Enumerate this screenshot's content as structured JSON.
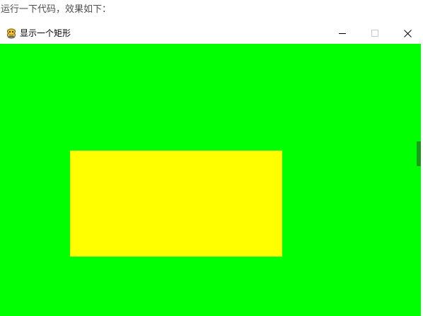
{
  "article": {
    "intro_text": "运行一下代码，效果如下："
  },
  "window": {
    "title": "显示一个矩形",
    "icon": "pygame-snake-icon",
    "controls": {
      "minimize": "minimize-icon",
      "maximize": "maximize-icon",
      "close": "close-icon"
    }
  },
  "canvas": {
    "background_color": "#00ff00",
    "shapes": [
      {
        "type": "rectangle",
        "color": "#ffff00"
      }
    ]
  },
  "colors": {
    "titlebar": "#ffffff",
    "canvas_edge_strip": "#1a9e1a"
  }
}
